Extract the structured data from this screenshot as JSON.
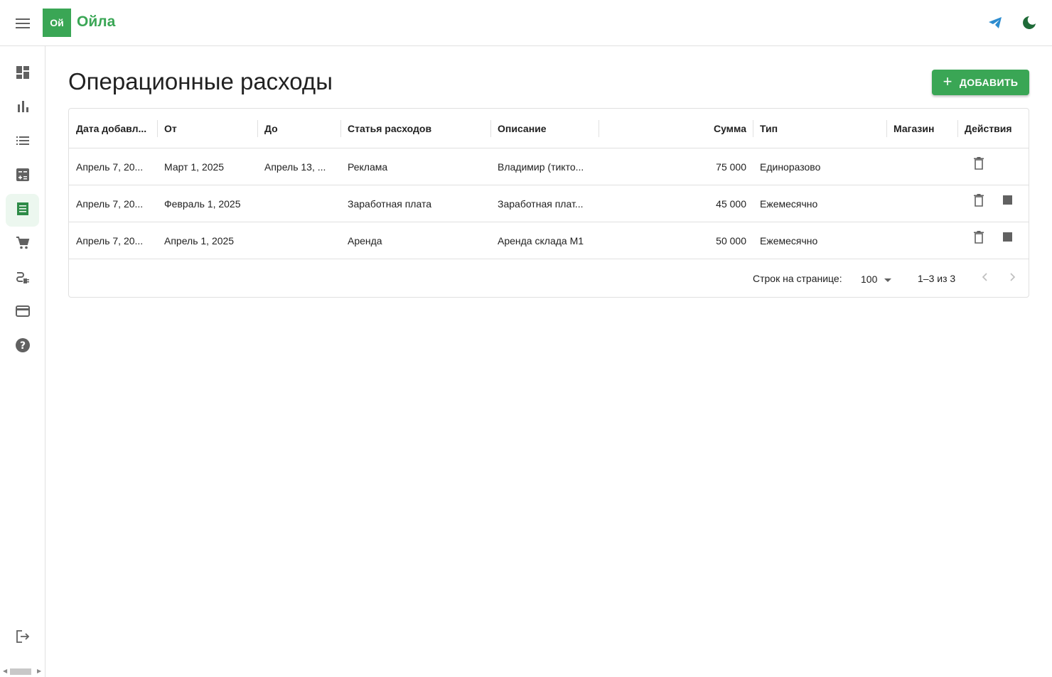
{
  "header": {
    "logo_text": "Ой",
    "app_name": "Ойла"
  },
  "icons": {
    "menu": "menu-icon",
    "telegram": "telegram-icon",
    "theme": "dark-mode-icon",
    "nav": [
      "dashboard-icon",
      "bar-chart-icon",
      "list-icon",
      "calculator-icon",
      "receipt-icon",
      "cart-icon",
      "link-icon",
      "credit-card-icon",
      "help-icon"
    ],
    "logout": "logout-icon",
    "delete": "delete-icon",
    "stop": "stop-icon",
    "add": "plus-icon"
  },
  "colors": {
    "brand": "#3aa655",
    "active_nav_bg": "#ecf7ef",
    "telegram": "#2c8ccf"
  },
  "page": {
    "title": "Операционные расходы",
    "add_button": "ДОБАВИТЬ"
  },
  "table": {
    "columns": [
      "Дата добавл...",
      "От",
      "До",
      "Статья расходов",
      "Описание",
      "Сумма",
      "Тип",
      "Магазин",
      "Действия"
    ],
    "rows": [
      {
        "added": "Апрель 7, 20...",
        "from": "Март 1, 2025",
        "to": "Апрель 13, ...",
        "category": "Реклама",
        "description": "Владимир (тикто...",
        "amount": "75 000",
        "type": "Единоразово",
        "store": "",
        "has_stop": false
      },
      {
        "added": "Апрель 7, 20...",
        "from": "Февраль 1, 2025",
        "to": "",
        "category": "Заработная плата",
        "description": "Заработная плат...",
        "amount": "45 000",
        "type": "Ежемесячно",
        "store": "",
        "has_stop": true
      },
      {
        "added": "Апрель 7, 20...",
        "from": "Апрель 1, 2025",
        "to": "",
        "category": "Аренда",
        "description": "Аренда склада М1",
        "amount": "50 000",
        "type": "Ежемесячно",
        "store": "",
        "has_stop": true
      }
    ],
    "footer": {
      "rows_per_page_label": "Строк на странице:",
      "rows_per_page_value": "100",
      "range": "1–3 из 3"
    }
  }
}
